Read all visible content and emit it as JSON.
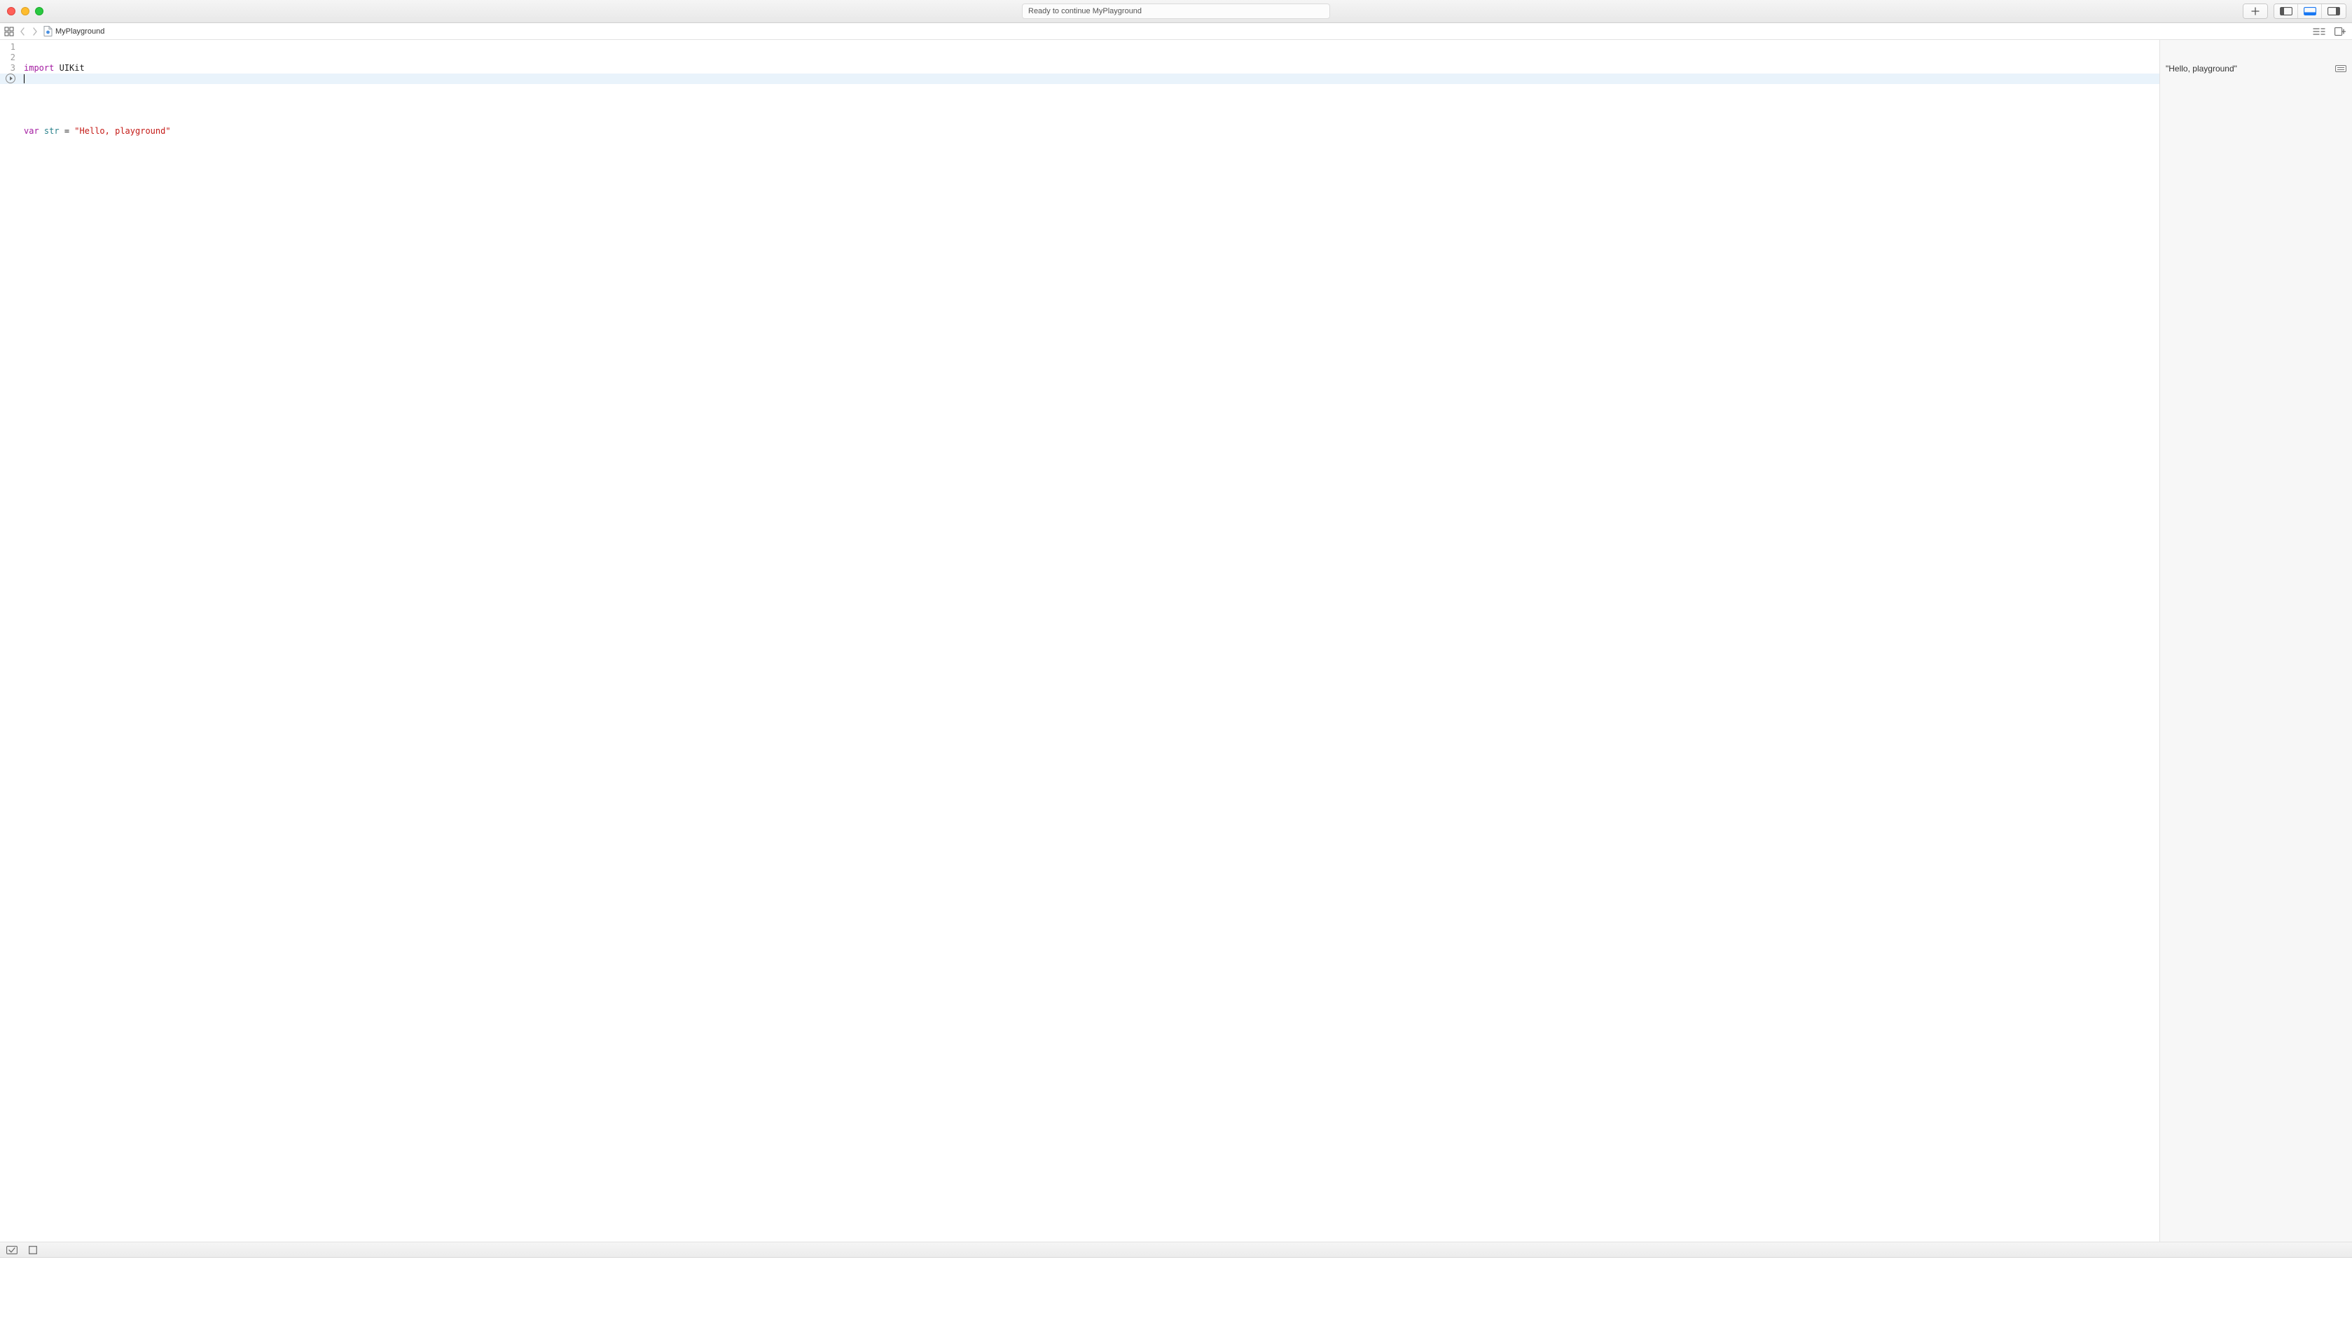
{
  "titlebar": {
    "status_text": "Ready to continue MyPlayground"
  },
  "pathbar": {
    "document_name": "MyPlayground"
  },
  "editor": {
    "lines": [
      {
        "n": "1"
      },
      {
        "n": "2"
      },
      {
        "n": "3"
      }
    ],
    "tokens": {
      "l1_import": "import",
      "l1_uikit": "UIKit",
      "l3_var": "var",
      "l3_ident": "str",
      "l3_eq": " = ",
      "l3_str": "\"Hello, playground\""
    },
    "current_line_index": 3
  },
  "results": {
    "row0": "\"Hello, playground\""
  }
}
